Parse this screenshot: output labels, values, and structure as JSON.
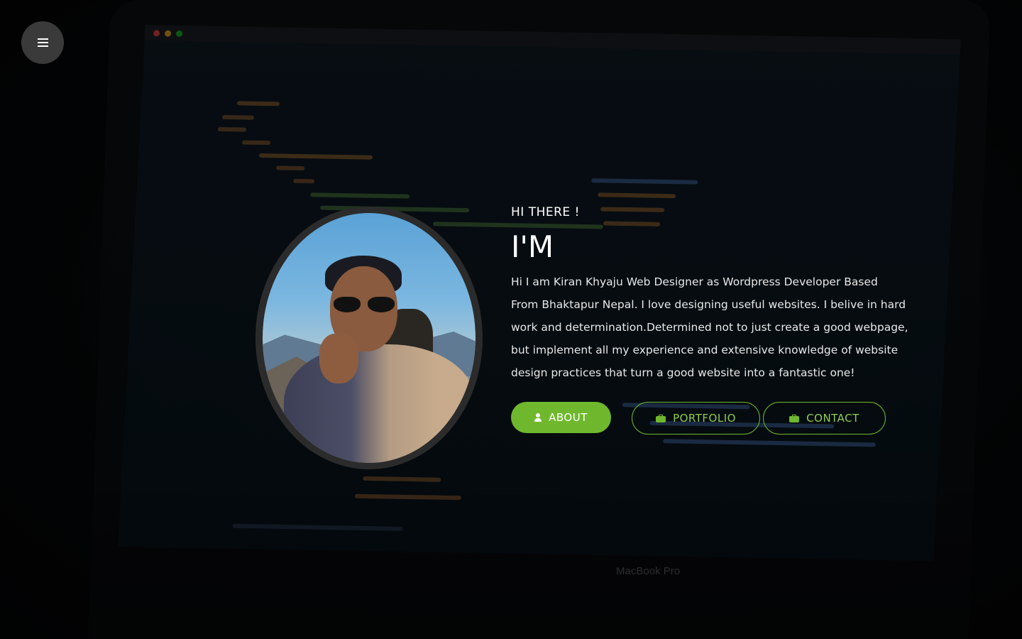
{
  "menu": {
    "icon": "hamburger-menu-icon"
  },
  "hero": {
    "greeting": "HI THERE !",
    "headline": "I'M",
    "bio": "Hi I am Kiran Khyaju Web Designer as Wordpress Developer Based From Bhaktapur Nepal. I love designing useful websites. I belive in hard work and determination.Determined not to just create a good webpage, but implement all my experience and extensive knowledge of website design practices that turn a good website into a fantastic one!"
  },
  "buttons": {
    "about": {
      "label": "ABOUT",
      "icon": "user-icon"
    },
    "portfolio": {
      "label": "PORTFOLIO",
      "icon": "briefcase-icon"
    },
    "contact": {
      "label": "CONTACT",
      "icon": "briefcase-icon"
    }
  },
  "background": {
    "brand_text": "MacBook Pro"
  },
  "colors": {
    "accent": "#6fb82e",
    "background": "#050607",
    "menu_button": "#3a3a3a"
  }
}
